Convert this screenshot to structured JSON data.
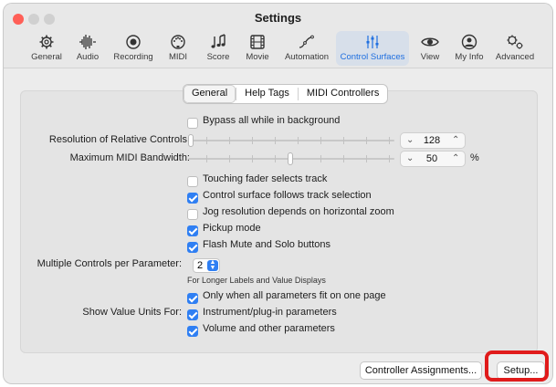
{
  "window": {
    "title": "Settings"
  },
  "toolbar": [
    {
      "label": "General",
      "icon": "gear-icon",
      "active": false
    },
    {
      "label": "Audio",
      "icon": "waveform-icon",
      "active": false
    },
    {
      "label": "Recording",
      "icon": "record-icon",
      "active": false
    },
    {
      "label": "MIDI",
      "icon": "midi-port-icon",
      "active": false
    },
    {
      "label": "Score",
      "icon": "music-notes-icon",
      "active": false
    },
    {
      "label": "Movie",
      "icon": "film-icon",
      "active": false
    },
    {
      "label": "Automation",
      "icon": "automation-curve-icon",
      "active": false
    },
    {
      "label": "Control Surfaces",
      "icon": "control-surfaces-icon",
      "active": true
    },
    {
      "label": "View",
      "icon": "eye-icon",
      "active": false
    },
    {
      "label": "My Info",
      "icon": "person-icon",
      "active": false
    },
    {
      "label": "Advanced",
      "icon": "gears-icon",
      "active": false
    }
  ],
  "tabs": [
    {
      "label": "General",
      "selected": true
    },
    {
      "label": "Help Tags",
      "selected": false
    },
    {
      "label": "MIDI Controllers",
      "selected": false
    }
  ],
  "settings": {
    "bypass": {
      "label": "Bypass all while in background",
      "checked": false
    },
    "relative": {
      "label": "Resolution of Relative Controls:",
      "value": "128",
      "slider_fraction": 0.0
    },
    "bandwidth": {
      "label": "Maximum MIDI Bandwidth:",
      "value": "50",
      "unit": "%",
      "slider_fraction": 0.5
    },
    "touching": {
      "label": "Touching fader selects track",
      "checked": false
    },
    "follows": {
      "label": "Control surface follows track selection",
      "checked": true
    },
    "jog": {
      "label": "Jog resolution depends on horizontal zoom",
      "checked": false
    },
    "pickup": {
      "label": "Pickup mode",
      "checked": true
    },
    "flash": {
      "label": "Flash Mute and Solo buttons",
      "checked": true
    },
    "multiple": {
      "label": "Multiple Controls per Parameter:",
      "value": "2",
      "note": "For Longer Labels and Value Displays"
    },
    "fit": {
      "label": "Only when all parameters fit on one page",
      "checked": true
    },
    "units_label": "Show Value Units For:",
    "instrument": {
      "label": "Instrument/plug-in parameters",
      "checked": true
    },
    "volume": {
      "label": "Volume and other parameters",
      "checked": true
    }
  },
  "buttons": {
    "assignments": "Controller Assignments...",
    "setup": "Setup..."
  },
  "colors": {
    "accent": "#2f7ff3",
    "highlight": "#e01b1b"
  }
}
